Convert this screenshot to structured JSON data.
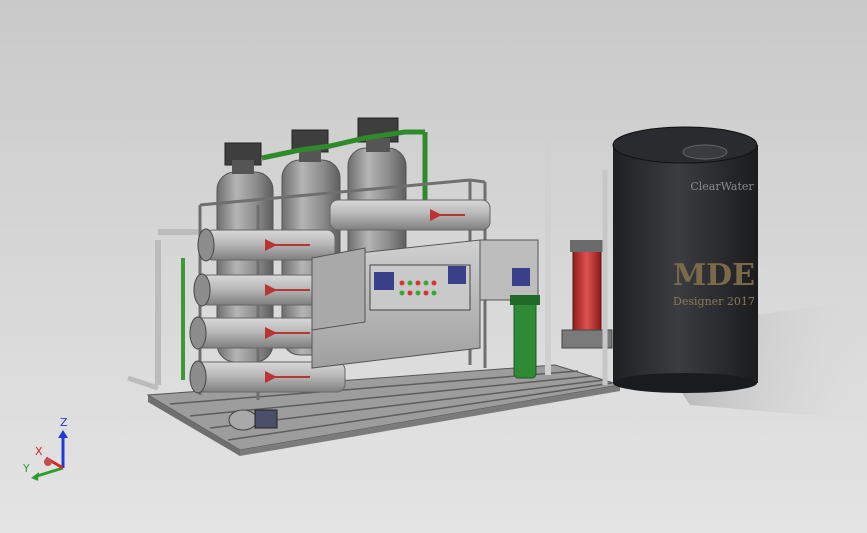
{
  "scene": {
    "tank": {
      "brand": "ClearWater",
      "logo": "MDE",
      "caption": "Designer 2017"
    },
    "triad": {
      "z_label": "Z",
      "x_label": "X",
      "y_label": "Y"
    },
    "colors": {
      "background_top": "#c9c9c9",
      "background_bottom": "#e4e4e4",
      "tank": "#2e2f33",
      "vessel": "#9a9a9a",
      "pipe": "#a8a8a8",
      "green_fitting": "#3a9a35",
      "pump_red": "#c23a3a",
      "frame": "#8a8a8a",
      "panel": "#bdbdbd",
      "axis_z": "#1f3bd6",
      "axis_x": "#d62828",
      "axis_y": "#2aa02a"
    }
  }
}
